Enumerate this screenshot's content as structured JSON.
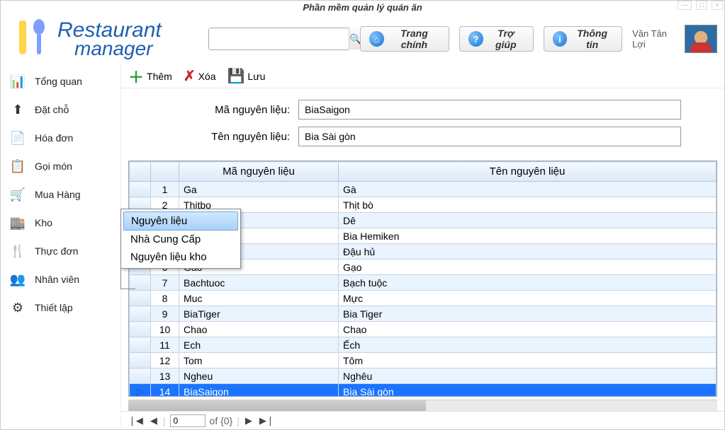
{
  "title": "Phần mềm quản lý quán ăn",
  "search": {
    "placeholder": ""
  },
  "header_buttons": {
    "home": "Trang chính",
    "help": "Trợ giúp",
    "info": "Thông tin"
  },
  "user": {
    "name": "Văn Tân Lợi"
  },
  "sidebar": [
    {
      "icon": "overview",
      "label": "Tổng quan"
    },
    {
      "icon": "reserve",
      "label": "Đặt chỗ"
    },
    {
      "icon": "invoice",
      "label": "Hóa đơn"
    },
    {
      "icon": "order",
      "label": "Gọi món"
    },
    {
      "icon": "cart",
      "label": "Mua Hàng"
    },
    {
      "icon": "warehouse",
      "label": "Kho"
    },
    {
      "icon": "menu",
      "label": "Thực đơn"
    },
    {
      "icon": "staff",
      "label": "Nhân viên"
    },
    {
      "icon": "settings",
      "label": "Thiết lập"
    }
  ],
  "submenu": {
    "items": [
      "Nguyên liệu",
      "Nhà Cung Cấp",
      "Nguyên liệu kho"
    ],
    "selected_index": 0
  },
  "toolbar": {
    "add": "Thêm",
    "delete": "Xóa",
    "save": "Lưu"
  },
  "form": {
    "code_label": "Mã nguyên liệu:",
    "code_value": "BiaSaigon",
    "name_label": "Tên nguyên liệu:",
    "name_value": "Bia Sài gòn"
  },
  "grid": {
    "headers": {
      "code": "Mã nguyên liệu",
      "name": "Tên nguyên liệu"
    },
    "rows": [
      {
        "n": "1",
        "code": "Ga",
        "name": "Gà"
      },
      {
        "n": "2",
        "code": "Thitbo",
        "name": "Thịt bò"
      },
      {
        "n": "3",
        "code": "",
        "name": "Dê"
      },
      {
        "n": "4",
        "code": "",
        "name": "Bia Hemiken"
      },
      {
        "n": "5",
        "code": "",
        "name": "Đậu hủ"
      },
      {
        "n": "6",
        "code": "Gao",
        "name": "Gạo"
      },
      {
        "n": "7",
        "code": "Bachtuoc",
        "name": "Bạch tuộc"
      },
      {
        "n": "8",
        "code": "Muc",
        "name": "Mực"
      },
      {
        "n": "9",
        "code": "BiaTiger",
        "name": "Bia Tiger"
      },
      {
        "n": "10",
        "code": "Chao",
        "name": "Chao"
      },
      {
        "n": "11",
        "code": "Ech",
        "name": "Ếch"
      },
      {
        "n": "12",
        "code": "Tom",
        "name": "Tôm"
      },
      {
        "n": "13",
        "code": "Ngheu",
        "name": "Nghêu"
      },
      {
        "n": "14",
        "code": "BiaSaigon",
        "name": "Bia Sài gòn"
      }
    ],
    "selected_index": 13
  },
  "pager": {
    "current": "0",
    "of_text": "of {0}"
  }
}
